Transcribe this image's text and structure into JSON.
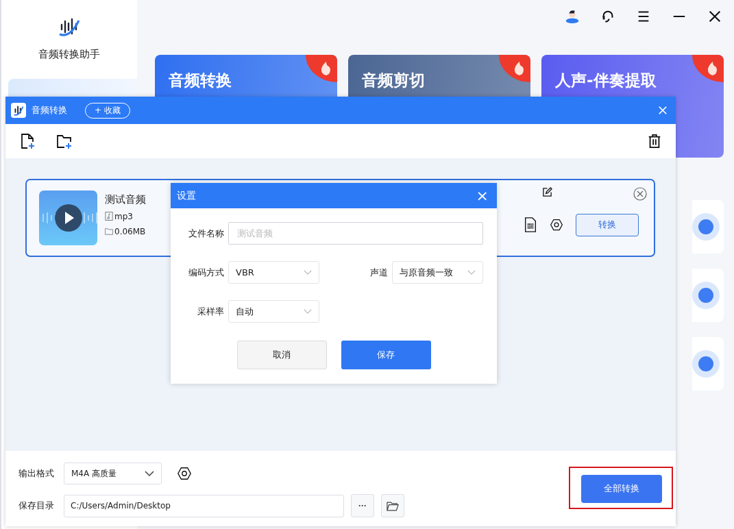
{
  "app": {
    "name": "音频转换助手"
  },
  "feature_cards": [
    {
      "title": "音频转换",
      "hot": true,
      "color": "#2f6ff0"
    },
    {
      "title": "音频剪切",
      "hot": true,
      "color": "#4b6694"
    },
    {
      "title": "人声-伴奏提取",
      "hot": true,
      "color": "#5a5cf0"
    }
  ],
  "converter": {
    "title": "音频转换",
    "favorite_label": "+ 收藏",
    "files": [
      {
        "name": "测试音频",
        "format": "mp3",
        "size": "0.06MB",
        "selected": true,
        "convert_label": "转换"
      }
    ],
    "output_format_label": "输出格式",
    "output_format": "M4A 高质量",
    "save_dir_label": "保存目录",
    "save_dir": "C:/Users/Admin/Desktop",
    "more_label": "···",
    "convert_all_label": "全部转换",
    "convert_all_highlighted": true
  },
  "settings_dialog": {
    "title": "设置",
    "close": "×",
    "fields": [
      {
        "label": "文件名称",
        "kind": "text",
        "placeholder": "测试音频"
      },
      {
        "label": "编码方式",
        "kind": "select",
        "value": "VBR"
      },
      {
        "label": "声道",
        "kind": "select",
        "value": "与原音频一致"
      },
      {
        "label": "采样率",
        "kind": "select",
        "value": "自动"
      }
    ],
    "buttons": [
      {
        "label": "取消",
        "primary": false
      },
      {
        "label": "保存",
        "primary": true
      }
    ]
  }
}
